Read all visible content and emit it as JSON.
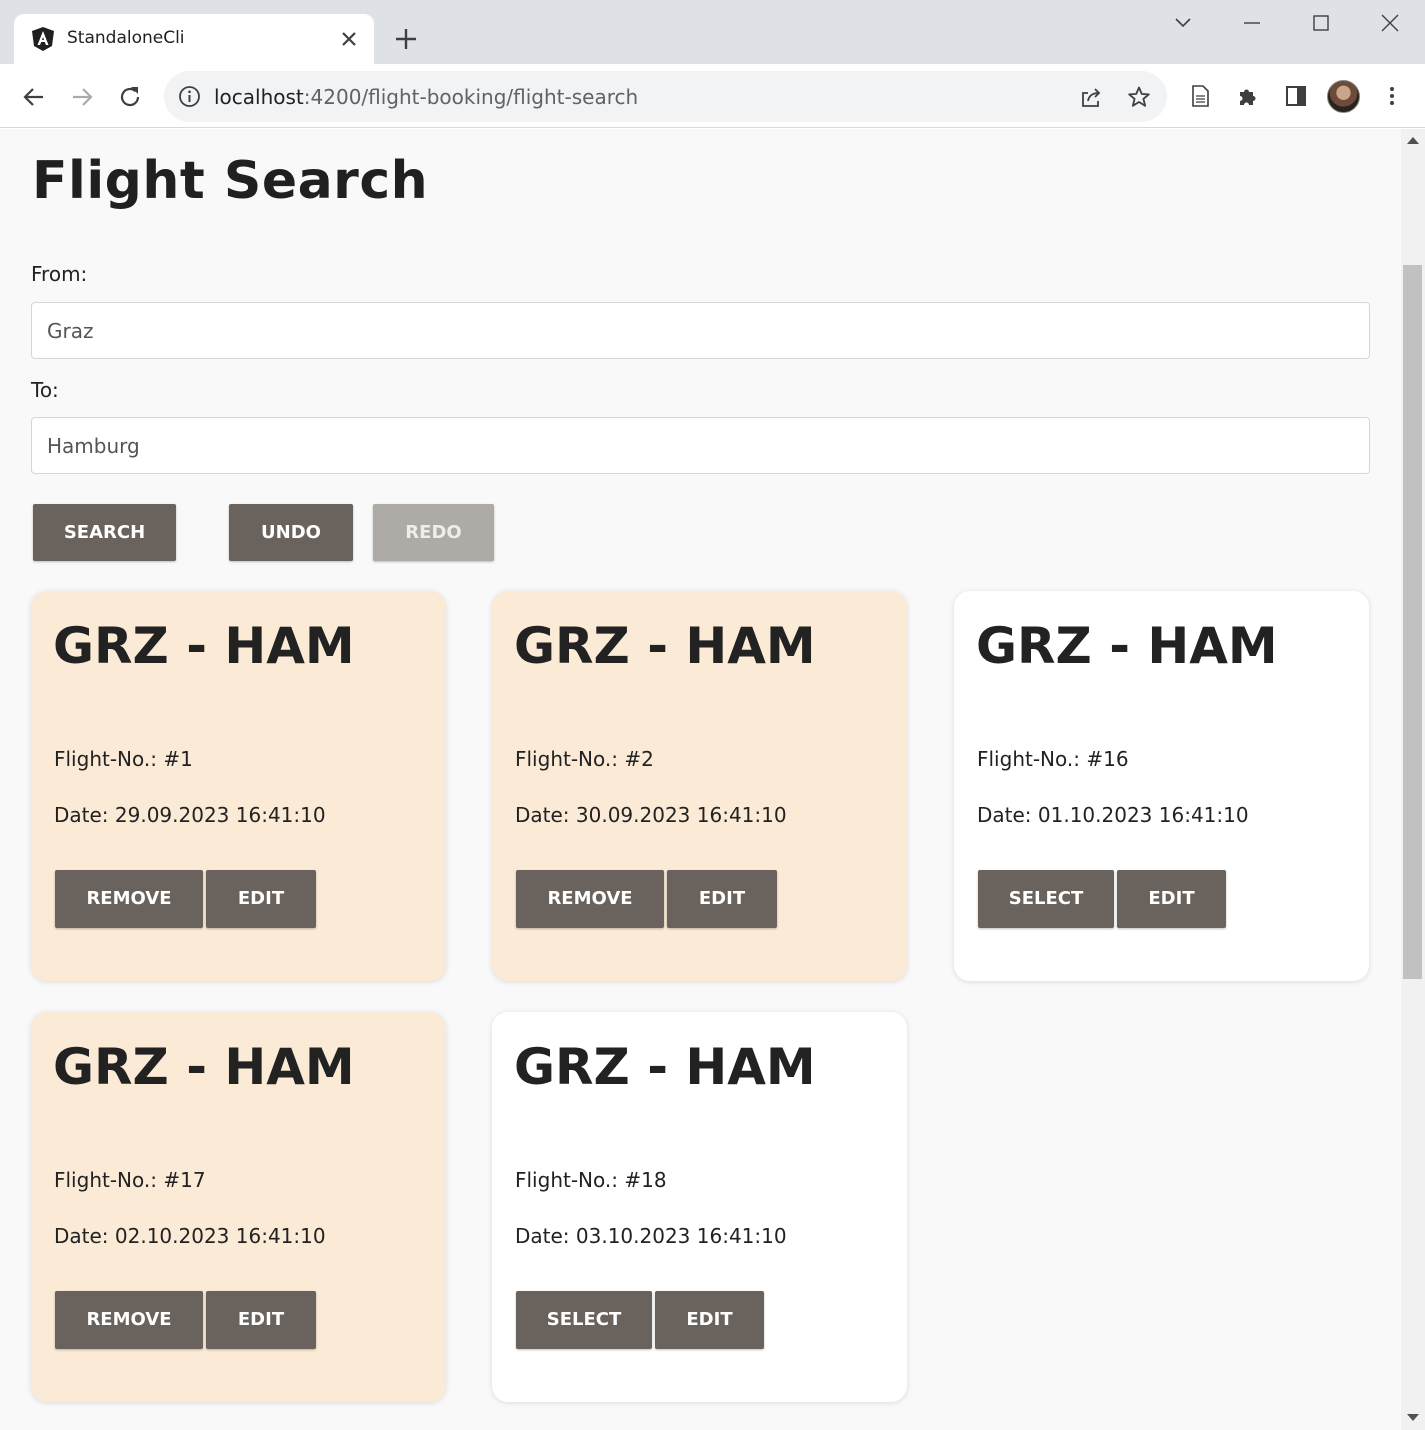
{
  "browser": {
    "tab_title": "StandaloneCli",
    "url_host": "localhost",
    "url_rest": ":4200/flight-booking/flight-search"
  },
  "page": {
    "title": "Flight Search",
    "from_label": "From:",
    "from_value": "Graz",
    "to_label": "To:",
    "to_value": "Hamburg",
    "search_label": "SEARCH",
    "undo_label": "UNDO",
    "redo_label": "REDO"
  },
  "flights": [
    {
      "route": "GRZ - HAM",
      "number": "Flight-No.: #1",
      "date": "Date: 29.09.2023 16:41:10",
      "action": "REMOVE",
      "edit": "EDIT",
      "selected": true
    },
    {
      "route": "GRZ - HAM",
      "number": "Flight-No.: #2",
      "date": "Date: 30.09.2023 16:41:10",
      "action": "REMOVE",
      "edit": "EDIT",
      "selected": true
    },
    {
      "route": "GRZ - HAM",
      "number": "Flight-No.: #16",
      "date": "Date: 01.10.2023 16:41:10",
      "action": "SELECT",
      "edit": "EDIT",
      "selected": false
    },
    {
      "route": "GRZ - HAM",
      "number": "Flight-No.: #17",
      "date": "Date: 02.10.2023 16:41:10",
      "action": "REMOVE",
      "edit": "EDIT",
      "selected": true
    },
    {
      "route": "GRZ - HAM",
      "number": "Flight-No.: #18",
      "date": "Date: 03.10.2023 16:41:10",
      "action": "SELECT",
      "edit": "EDIT",
      "selected": false
    }
  ],
  "colors": {
    "selected_card": "#faead6",
    "button": "#6a625c",
    "button_disabled": "#aeaaa6"
  }
}
